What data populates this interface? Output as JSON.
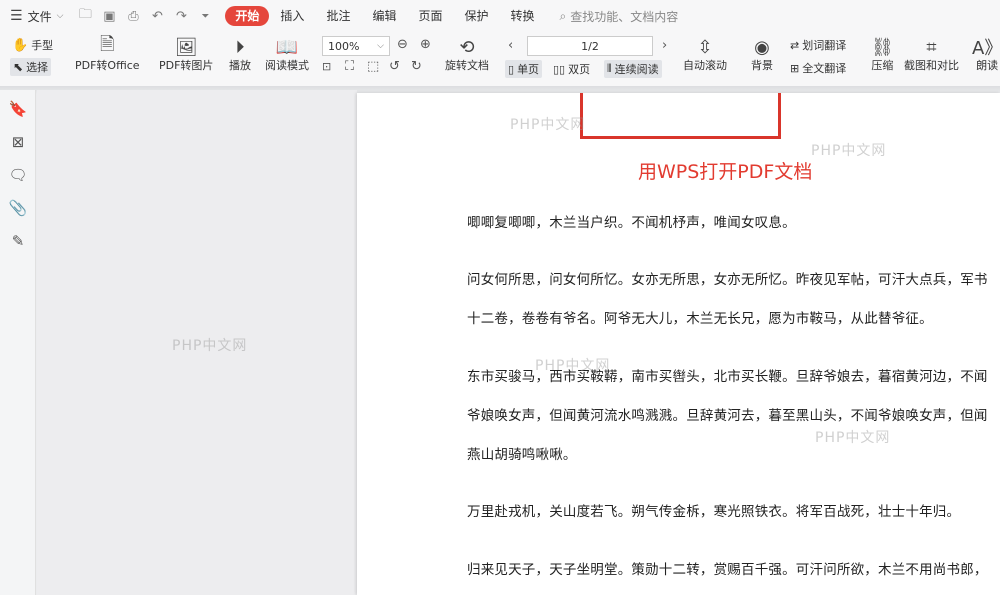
{
  "menubar": {
    "file_label": "文件",
    "tabs": [
      {
        "label": "开始",
        "active": true
      },
      {
        "label": "插入"
      },
      {
        "label": "批注"
      },
      {
        "label": "编辑"
      },
      {
        "label": "页面"
      },
      {
        "label": "保护"
      },
      {
        "label": "转换"
      }
    ],
    "search_placeholder": "查找功能、文档内容"
  },
  "toolbar": {
    "hand_label": "手型",
    "select_label": "选择",
    "pdf_to_office": "PDF转Office",
    "pdf_to_image": "PDF转图片",
    "play": "播放",
    "read_mode": "阅读模式",
    "zoom": "100%",
    "rotate_doc": "旋转文档",
    "page_indicator": "1/2",
    "single_page": "单页",
    "double_page": "双页",
    "continuous": "连续阅读",
    "auto_scroll": "自动滚动",
    "background": "背景",
    "word_translate": "划词翻译",
    "full_translate": "全文翻译",
    "compress": "压缩",
    "screenshot_compare": "截图和对比",
    "read_aloud": "朗读"
  },
  "document": {
    "caption": "用WPS打开PDF文档",
    "paragraphs": [
      "唧唧复唧唧，木兰当户织。不闻机杼声，唯闻女叹息。",
      "问女何所思，问女何所忆。女亦无所思，女亦无所忆。昨夜见军帖，可汗大点兵，军书",
      "十二卷，卷卷有爷名。阿爷无大儿，木兰无长兄，愿为市鞍马，从此替爷征。",
      "东市买骏马，西市买鞍鞯，南市买辔头，北市买长鞭。旦辞爷娘去，暮宿黄河边，不闻",
      "爷娘唤女声，但闻黄河流水鸣溅溅。旦辞黄河去，暮至黑山头，不闻爷娘唤女声，但闻",
      "燕山胡骑鸣啾啾。",
      "万里赴戎机，关山度若飞。朔气传金柝，寒光照铁衣。将军百战死，壮士十年归。",
      "归来见天子，天子坐明堂。策勋十二转，赏赐百千强。可汗问所欲，木兰不用尚书郎，"
    ]
  },
  "watermark": "PHP中文网",
  "colors": {
    "accent": "#e5463c",
    "highlight_box": "#d9352b",
    "caption": "#e23b30"
  }
}
